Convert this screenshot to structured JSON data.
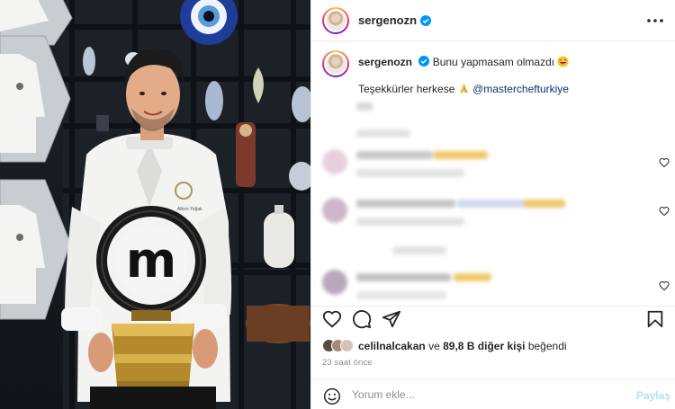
{
  "post": {
    "username": "sergenozn",
    "caption_main": "Bunu yapmasam olmazdı",
    "caption_emoji": "laughing-emoji",
    "caption_thanks": "Teşekkürler herkese",
    "caption_thanks_emoji": "praying-hands-emoji",
    "caption_mention": "@masterchefturkiye"
  },
  "photo": {
    "trophy_logo": "m",
    "jacket_badge": "MasterChef"
  },
  "actions": {
    "like_icon": "heart-icon",
    "comment_icon": "comment-bubble-icon",
    "share_icon": "paper-plane-icon",
    "save_icon": "bookmark-icon"
  },
  "likes": {
    "user": "celilnalcakan",
    "connector": "ve",
    "count_text": "89,8 B diğer kişi",
    "suffix": "beğendi"
  },
  "timestamp": "23 saat önce",
  "comment_box": {
    "placeholder": "Yorum ekle...",
    "post_label": "Paylaş"
  },
  "colors": {
    "link": "#00376b",
    "verified": "#0095f6",
    "muted": "#8e8e8e",
    "post_disabled": "#b2dffc"
  }
}
